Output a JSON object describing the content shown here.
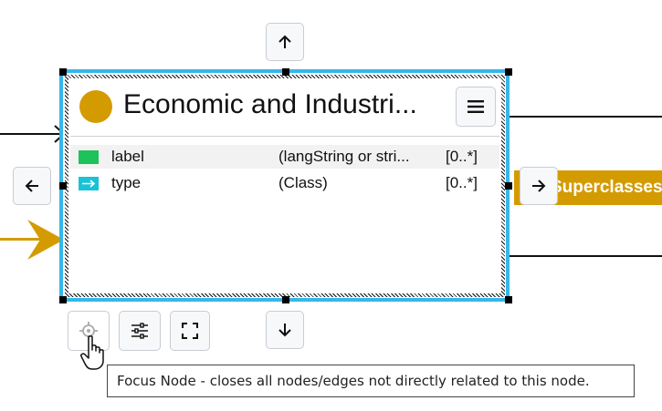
{
  "node": {
    "title": "Economic and Industri...",
    "color": "#d49b00",
    "selection_color": "#35b7ea",
    "menu_icon": "hamburger-menu-icon",
    "properties": [
      {
        "name": "label",
        "type": "(langString or stri...",
        "cardinality": "[0..*]",
        "icon": "green-square-icon",
        "color": "#1ec25a"
      },
      {
        "name": "type",
        "type": "(Class)",
        "cardinality": "[0..*]",
        "icon": "cyan-arrow-icon",
        "color": "#19c2d6"
      }
    ]
  },
  "edges": {
    "superclasses_label": "Superclasses",
    "superclasses_color": "#d49b00"
  },
  "nav_buttons": {
    "up_icon": "arrow-up-icon",
    "down_icon": "arrow-down-icon",
    "left_icon": "arrow-left-icon",
    "right_icon": "arrow-right-icon"
  },
  "toolbar": {
    "focus_icon": "crosshair-icon",
    "settings_icon": "sliders-icon",
    "expand_icon": "expand-icon"
  },
  "tooltip": {
    "text": "Focus Node - closes all nodes/edges not directly related to this node."
  }
}
